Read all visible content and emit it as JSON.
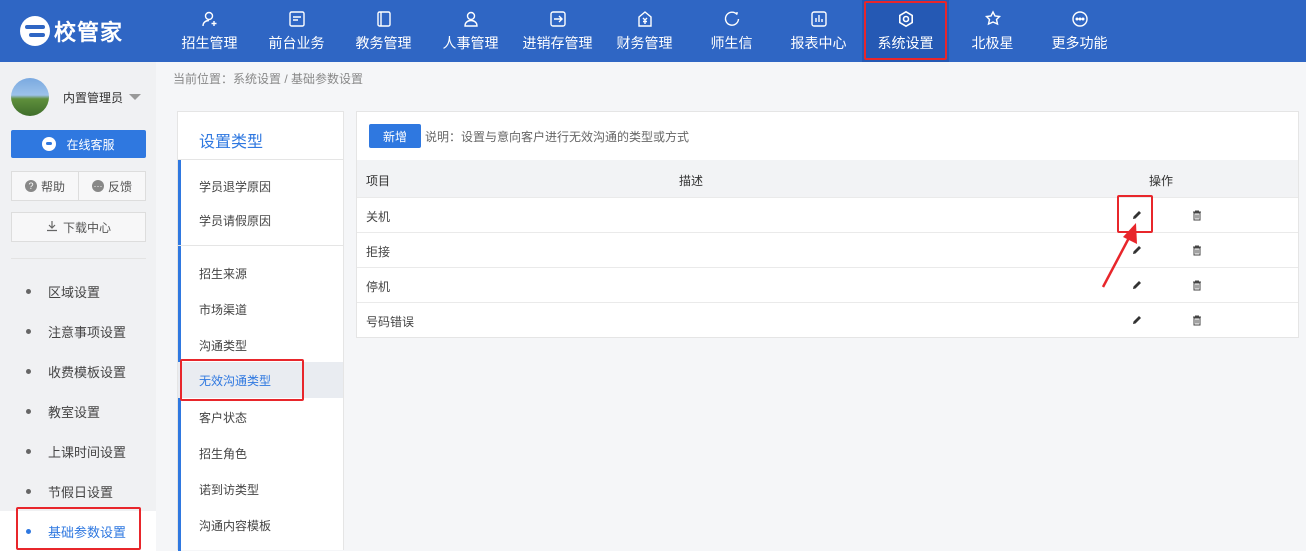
{
  "app": {
    "logo_text": "校管家"
  },
  "nav": [
    {
      "label": "招生管理",
      "icon": "person-add-icon"
    },
    {
      "label": "前台业务",
      "icon": "monitor-icon"
    },
    {
      "label": "教务管理",
      "icon": "book-icon"
    },
    {
      "label": "人事管理",
      "icon": "person-icon"
    },
    {
      "label": "进销存管理",
      "icon": "transfer-icon"
    },
    {
      "label": "财务管理",
      "icon": "yuan-icon"
    },
    {
      "label": "师生信",
      "icon": "chat-icon"
    },
    {
      "label": "报表中心",
      "icon": "report-icon"
    },
    {
      "label": "系统设置",
      "icon": "settings-icon",
      "active": true
    },
    {
      "label": "北极星",
      "icon": "star-icon"
    },
    {
      "label": "更多功能",
      "icon": "more-icon"
    }
  ],
  "user": {
    "name": "内置管理员"
  },
  "sidebar": {
    "service_label": "在线客服",
    "help_label": "帮助",
    "feedback_label": "反馈",
    "download_label": "下载中心",
    "items": [
      {
        "label": "区域设置"
      },
      {
        "label": "注意事项设置"
      },
      {
        "label": "收费模板设置"
      },
      {
        "label": "教室设置"
      },
      {
        "label": "上课时间设置"
      },
      {
        "label": "节假日设置"
      },
      {
        "label": "基础参数设置",
        "active": true
      }
    ]
  },
  "breadcrumb": "当前位置：系统设置 / 基础参数设置",
  "categories": {
    "title": "设置类型",
    "items": [
      "学员退学原因",
      "学员请假原因",
      "招生来源",
      "市场渠道",
      "沟通类型",
      "无效沟通类型",
      "客户状态",
      "招生角色",
      "诺到访类型",
      "沟通内容模板"
    ],
    "active_index": 5
  },
  "main": {
    "new_label": "新增",
    "note": "说明：设置与意向客户进行无效沟通的类型或方式",
    "headers": {
      "item": "项目",
      "desc": "描述",
      "ops": "操作"
    },
    "rows": [
      {
        "item": "关机",
        "desc": ""
      },
      {
        "item": "拒接",
        "desc": ""
      },
      {
        "item": "停机",
        "desc": ""
      },
      {
        "item": "号码错误",
        "desc": ""
      }
    ]
  },
  "colors": {
    "primary": "#2f66c4",
    "accent": "#2f78e0",
    "highlight": "#e8262b"
  }
}
